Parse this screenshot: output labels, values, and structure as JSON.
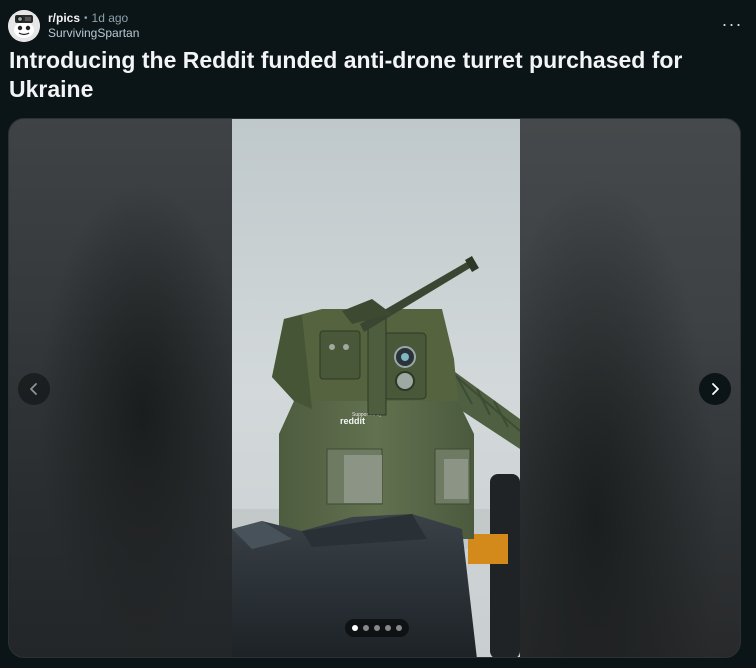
{
  "post": {
    "subreddit": "r/pics",
    "separator": "•",
    "time_ago": "1d ago",
    "author": "SurvivingSpartan",
    "more_icon": "more-horizontal-icon",
    "more_label": "···",
    "title": "Introducing the Reddit funded anti-drone turret purchased for Ukraine"
  },
  "gallery": {
    "image_alt": "Anti-drone turret on an armored vehicle",
    "turret_brand": "reddit",
    "prev_icon": "chevron-left-icon",
    "next_icon": "chevron-right-icon",
    "slide_count": 5,
    "active_slide": 1
  },
  "colors": {
    "background": "#0b1416",
    "title": "#f2f4f5",
    "meta": "#8ba2ad",
    "turret_green": "#5b6b4a",
    "sky": "#c9d0d2"
  }
}
